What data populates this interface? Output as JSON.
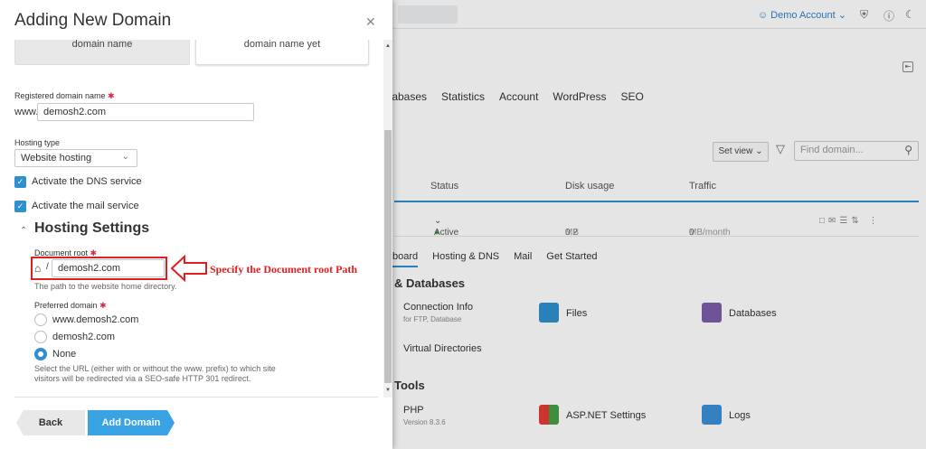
{
  "background": {
    "account_label": "Demo Account",
    "tabs": [
      "tabases",
      "Statistics",
      "Account",
      "WordPress",
      "SEO"
    ],
    "set_view": "Set view",
    "find_placeholder": "Find domain...",
    "columns": [
      "Status",
      "Disk usage",
      "Traffic"
    ],
    "row": {
      "status": "Active",
      "disk": "0.2",
      "disk_unit": "MB",
      "traffic": "0",
      "traffic_unit": "MB/month"
    },
    "subtabs": [
      "board",
      "Hosting & DNS",
      "Mail",
      "Get Started"
    ],
    "section_files": "& Databases",
    "items": {
      "connection_info": "Connection Info",
      "connection_info_sub": "for FTP, Database",
      "files": "Files",
      "databases": "Databases",
      "virtual_directories": "Virtual Directories",
      "tools": "Tools",
      "php": "PHP",
      "php_sub": "Version 8.3.6",
      "aspnet": "ASP.NET Settings",
      "logs": "Logs"
    }
  },
  "modal": {
    "title": "Adding New Domain",
    "choice_left": "domain name",
    "choice_right": "domain name yet",
    "registered_label": "Registered domain name",
    "www_prefix": "www.",
    "domain_value": "demosh2.com",
    "hosting_type_label": "Hosting type",
    "hosting_type_value": "Website hosting",
    "dns_label": "Activate the DNS service",
    "mail_label": "Activate the mail service",
    "hosting_settings": "Hosting Settings",
    "docroot_label": "Document root",
    "docroot_value": "demosh2.com",
    "docroot_hint": "The path to the website home directory.",
    "preferred_label": "Preferred domain",
    "options": [
      "www.demosh2.com",
      "demosh2.com",
      "None"
    ],
    "selected_option": "None",
    "preferred_hint_1": "Select the URL (either with or without the www. prefix) to which site",
    "preferred_hint_2": "visitors will be redirected via a SEO-safe HTTP 301 redirect.",
    "back_label": "Back",
    "add_label": "Add Domain"
  },
  "annotation": {
    "text": "Specify the Document root Path",
    "color": "#e02020"
  },
  "colors": {
    "accent": "#2f8fcf",
    "primary_button": "#3aa3e3",
    "required": "#d02d4b"
  }
}
